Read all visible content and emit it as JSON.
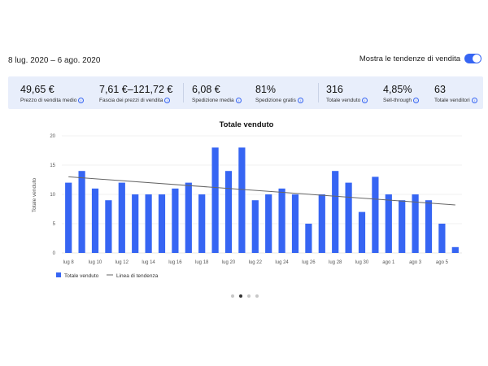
{
  "header": {
    "date_range": "8 lug. 2020 – 6 ago. 2020",
    "trend_toggle_label": "Mostra le tendenze di vendita",
    "trend_toggle_on": true
  },
  "stats": [
    {
      "value": "49,65 €",
      "label": "Prezzo di vendita medio"
    },
    {
      "value": "7,61 €–121,72 €",
      "label": "Fascia dei prezzi di vendita"
    },
    {
      "value": "6,08 €",
      "label": "Spedizione media"
    },
    {
      "value": "81%",
      "label": "Spedizione gratis"
    },
    {
      "value": "316",
      "label": "Totale venduto"
    },
    {
      "value": "4,85%",
      "label": "Sell-through"
    },
    {
      "value": "63",
      "label": "Totale venditori"
    }
  ],
  "info_icon_glyph": "i",
  "chart_data": {
    "type": "bar",
    "title": "Totale venduto",
    "xlabel": "",
    "ylabel": "Totale venduto",
    "ylim": [
      0,
      20
    ],
    "yticks": [
      0,
      5,
      10,
      15,
      20
    ],
    "categories": [
      "lug 8",
      "lug 9",
      "lug 10",
      "lug 11",
      "lug 12",
      "lug 13",
      "lug 14",
      "lug 15",
      "lug 16",
      "lug 17",
      "lug 18",
      "lug 19",
      "lug 20",
      "lug 21",
      "lug 22",
      "lug 23",
      "lug 24",
      "lug 25",
      "lug 26",
      "lug 27",
      "lug 28",
      "lug 29",
      "lug 30",
      "lug 31",
      "ago 1",
      "ago 2",
      "ago 3",
      "ago 4",
      "ago 5",
      "ago 6"
    ],
    "tick_labels": [
      "lug 8",
      "lug 10",
      "lug 12",
      "lug 14",
      "lug 16",
      "lug 18",
      "lug 20",
      "lug 22",
      "lug 24",
      "lug 26",
      "lug 28",
      "lug 30",
      "ago 1",
      "ago 3",
      "ago 5"
    ],
    "series": [
      {
        "name": "Totale venduto",
        "values": [
          12,
          14,
          11,
          9,
          12,
          10,
          10,
          10,
          11,
          12,
          10,
          18,
          14,
          18,
          9,
          10,
          11,
          10,
          5,
          10,
          14,
          12,
          7,
          13,
          10,
          9,
          10,
          9,
          5,
          1
        ]
      }
    ],
    "trend": {
      "name": "Linea di tendenza",
      "start": 13.0,
      "end": 8.2
    },
    "grid": true,
    "legend_position": "bottom-left",
    "colors": {
      "bar": "#3665f3",
      "trend": "#666666",
      "grid": "#e5e5e5"
    }
  },
  "pager": {
    "count": 4,
    "active_index": 1
  }
}
